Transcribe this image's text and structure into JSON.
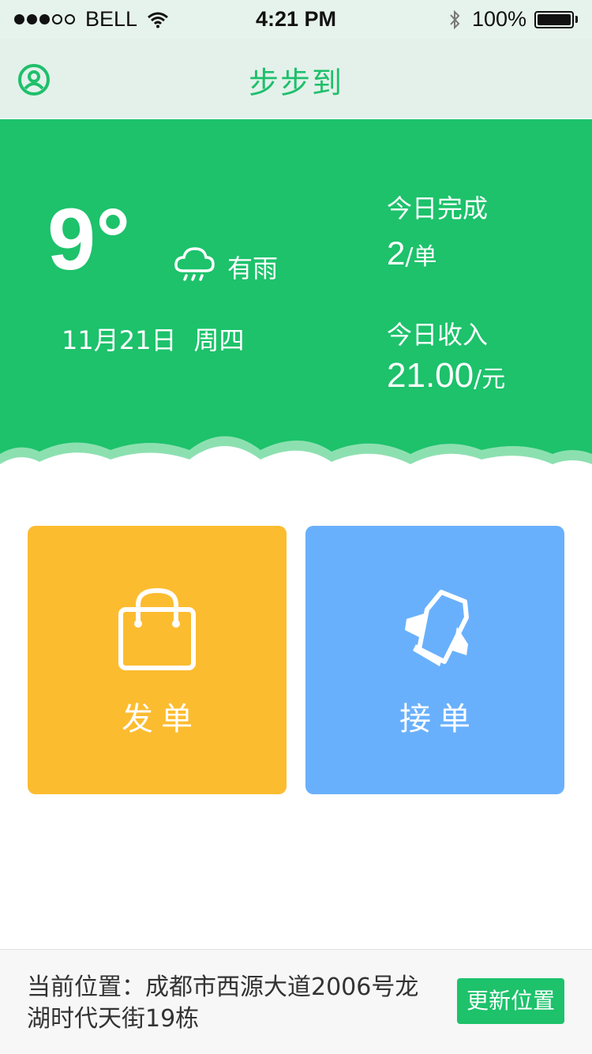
{
  "status_bar": {
    "carrier": "BELL",
    "time": "4:21 PM",
    "battery": "100%"
  },
  "nav": {
    "title": "步步到"
  },
  "weather": {
    "temperature": "9°",
    "condition": "有雨",
    "date": "11月21日",
    "weekday": "周四"
  },
  "stats": {
    "done_label": "今日完成",
    "done_value": "2",
    "done_unit": "/单",
    "income_label": "今日收入",
    "income_value": "21.00",
    "income_unit": "/元"
  },
  "actions": {
    "send_label": "发单",
    "receive_label": "接单"
  },
  "footer": {
    "location_label": "当前位置：",
    "address": "成都市西源大道2006号龙湖时代天街19栋",
    "update_button": "更新位置"
  },
  "colors": {
    "brand_green": "#1dc26b",
    "send_tile": "#fcbc30",
    "receive_tile": "#69b0fc"
  },
  "icons": [
    "profile-icon",
    "cloud-rain-icon",
    "shopping-bag-icon",
    "rocket-icon",
    "wifi-icon",
    "bluetooth-icon",
    "battery-icon"
  ]
}
